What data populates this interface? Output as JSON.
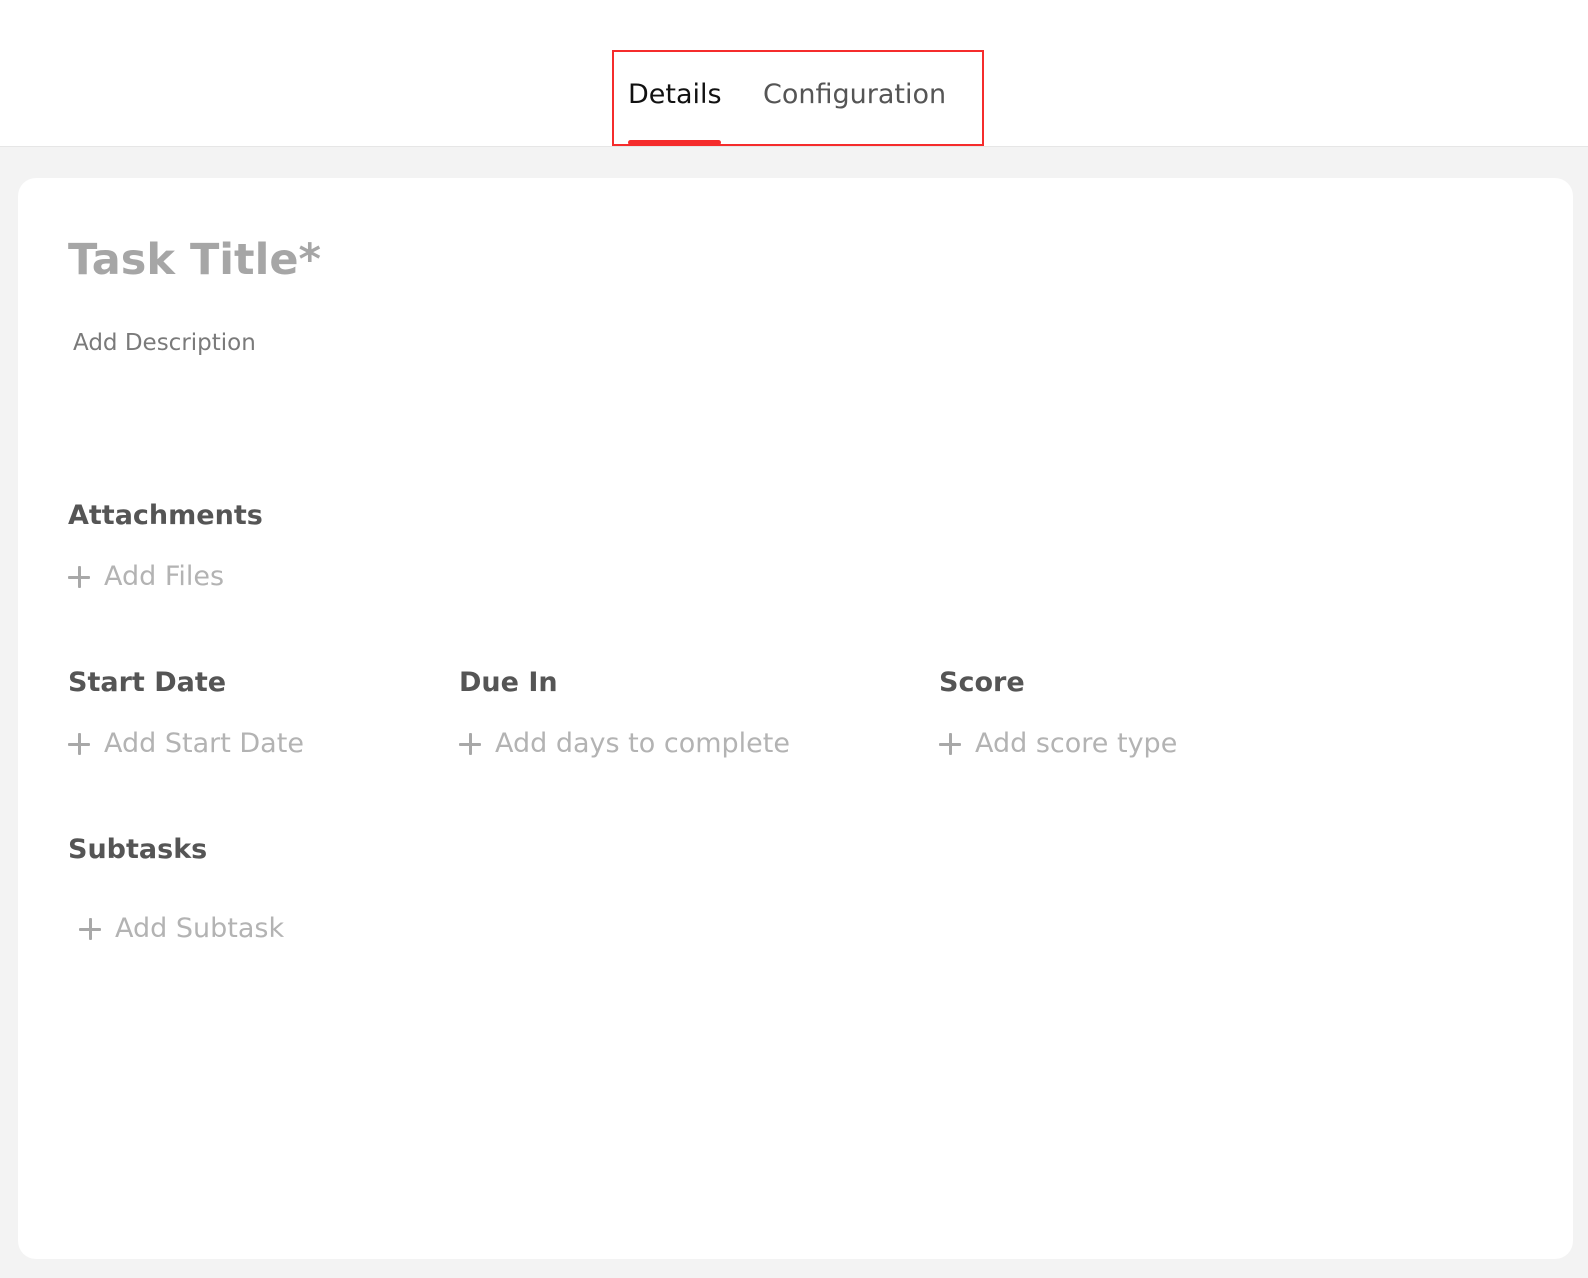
{
  "tabs": {
    "details_label": "Details",
    "configuration_label": "Configuration",
    "active": "Details"
  },
  "task": {
    "title_placeholder": "Task Title*",
    "description_placeholder": "Add Description"
  },
  "attachments": {
    "heading": "Attachments",
    "add_label": "Add Files"
  },
  "start_date": {
    "heading": "Start Date",
    "add_label": "Add Start Date"
  },
  "due_in": {
    "heading": "Due In",
    "add_label": "Add days to complete"
  },
  "score": {
    "heading": "Score",
    "add_label": "Add score type"
  },
  "subtasks": {
    "heading": "Subtasks",
    "add_label": "Add Subtask"
  },
  "icons": {
    "add": "plus-icon"
  },
  "colors": {
    "accent": "#f52c2c",
    "active_tab_text": "#111111",
    "inactive_tab_text": "#555555",
    "placeholder": "#b3b3b3",
    "page_background": "#f3f3f3"
  }
}
